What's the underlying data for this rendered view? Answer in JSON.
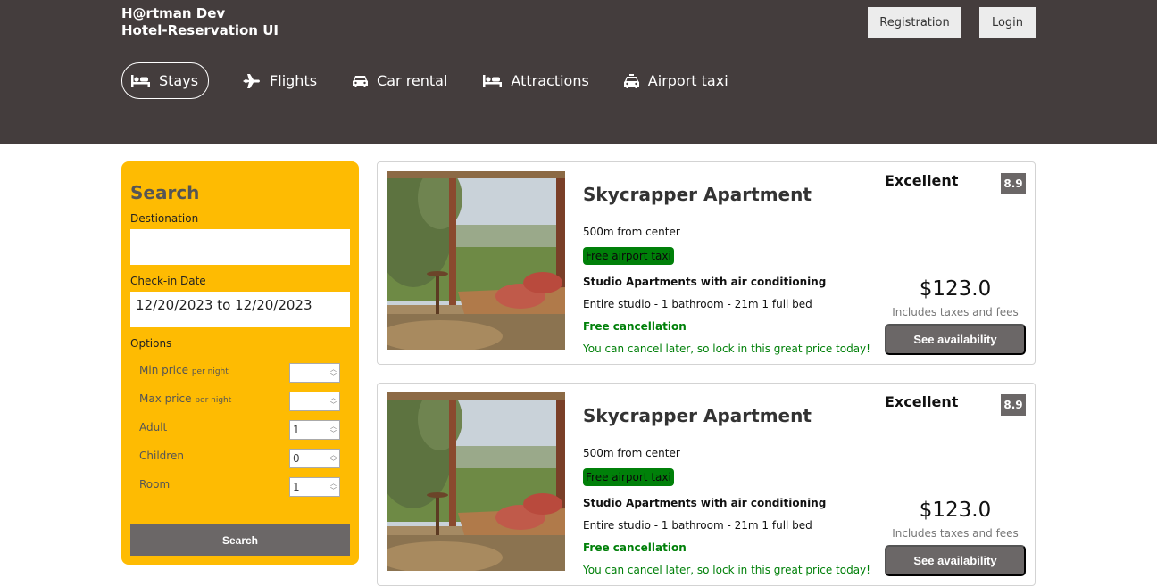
{
  "header": {
    "brand_line1": "H@rtman Dev",
    "brand_line2": "Hotel-Reservation UI",
    "registration_label": "Registration",
    "login_label": "Login",
    "nav": [
      {
        "label": "Stays",
        "icon": "bed-icon",
        "active": true
      },
      {
        "label": "Flights",
        "icon": "plane-icon"
      },
      {
        "label": "Car rental",
        "icon": "car-icon"
      },
      {
        "label": "Attractions",
        "icon": "bed-icon"
      },
      {
        "label": "Airport taxi",
        "icon": "taxi-icon"
      }
    ]
  },
  "search": {
    "title": "Search",
    "destination_label": "Destionation",
    "destination_value": "",
    "checkin_label": "Check-in Date",
    "checkin_value": "12/20/2023 to 12/20/2023",
    "options_label": "Options",
    "options": [
      {
        "label": "Min price",
        "sub": "per night",
        "value": ""
      },
      {
        "label": "Max price",
        "sub": "per night",
        "value": ""
      },
      {
        "label": "Adult",
        "sub": "",
        "value": "1"
      },
      {
        "label": "Children",
        "sub": "",
        "value": "0"
      },
      {
        "label": "Room",
        "sub": "",
        "value": "1"
      }
    ],
    "button_label": "Search"
  },
  "results": [
    {
      "title": "Skycrapper Apartment",
      "distance": "500m from center",
      "taxi": "Free airport taxi",
      "subtitle": "Studio Apartments with air conditioning",
      "features": "Entire studio - 1 bathroom - 21m 1 full bed",
      "cancel": "Free cancellation",
      "cancel_sub": "You can cancel later, so lock in this great price today!",
      "rating_text": "Excellent",
      "score": "8.9",
      "price": "$123.0",
      "tax": "Includes taxes and fees",
      "button": "See availability"
    },
    {
      "title": "Skycrapper Apartment",
      "distance": "500m from center",
      "taxi": "Free airport taxi",
      "subtitle": "Studio Apartments with air conditioning",
      "features": "Entire studio - 1 bathroom - 21m 1 full bed",
      "cancel": "Free cancellation",
      "cancel_sub": "You can cancel later, so lock in this great price today!",
      "rating_text": "Excellent",
      "score": "8.9",
      "price": "$123.0",
      "tax": "Includes taxes and fees",
      "button": "See availability"
    }
  ],
  "colors": {
    "header": "#443d3d",
    "sidebar": "#febb02",
    "button": "#6b6767",
    "green": "#008009"
  }
}
